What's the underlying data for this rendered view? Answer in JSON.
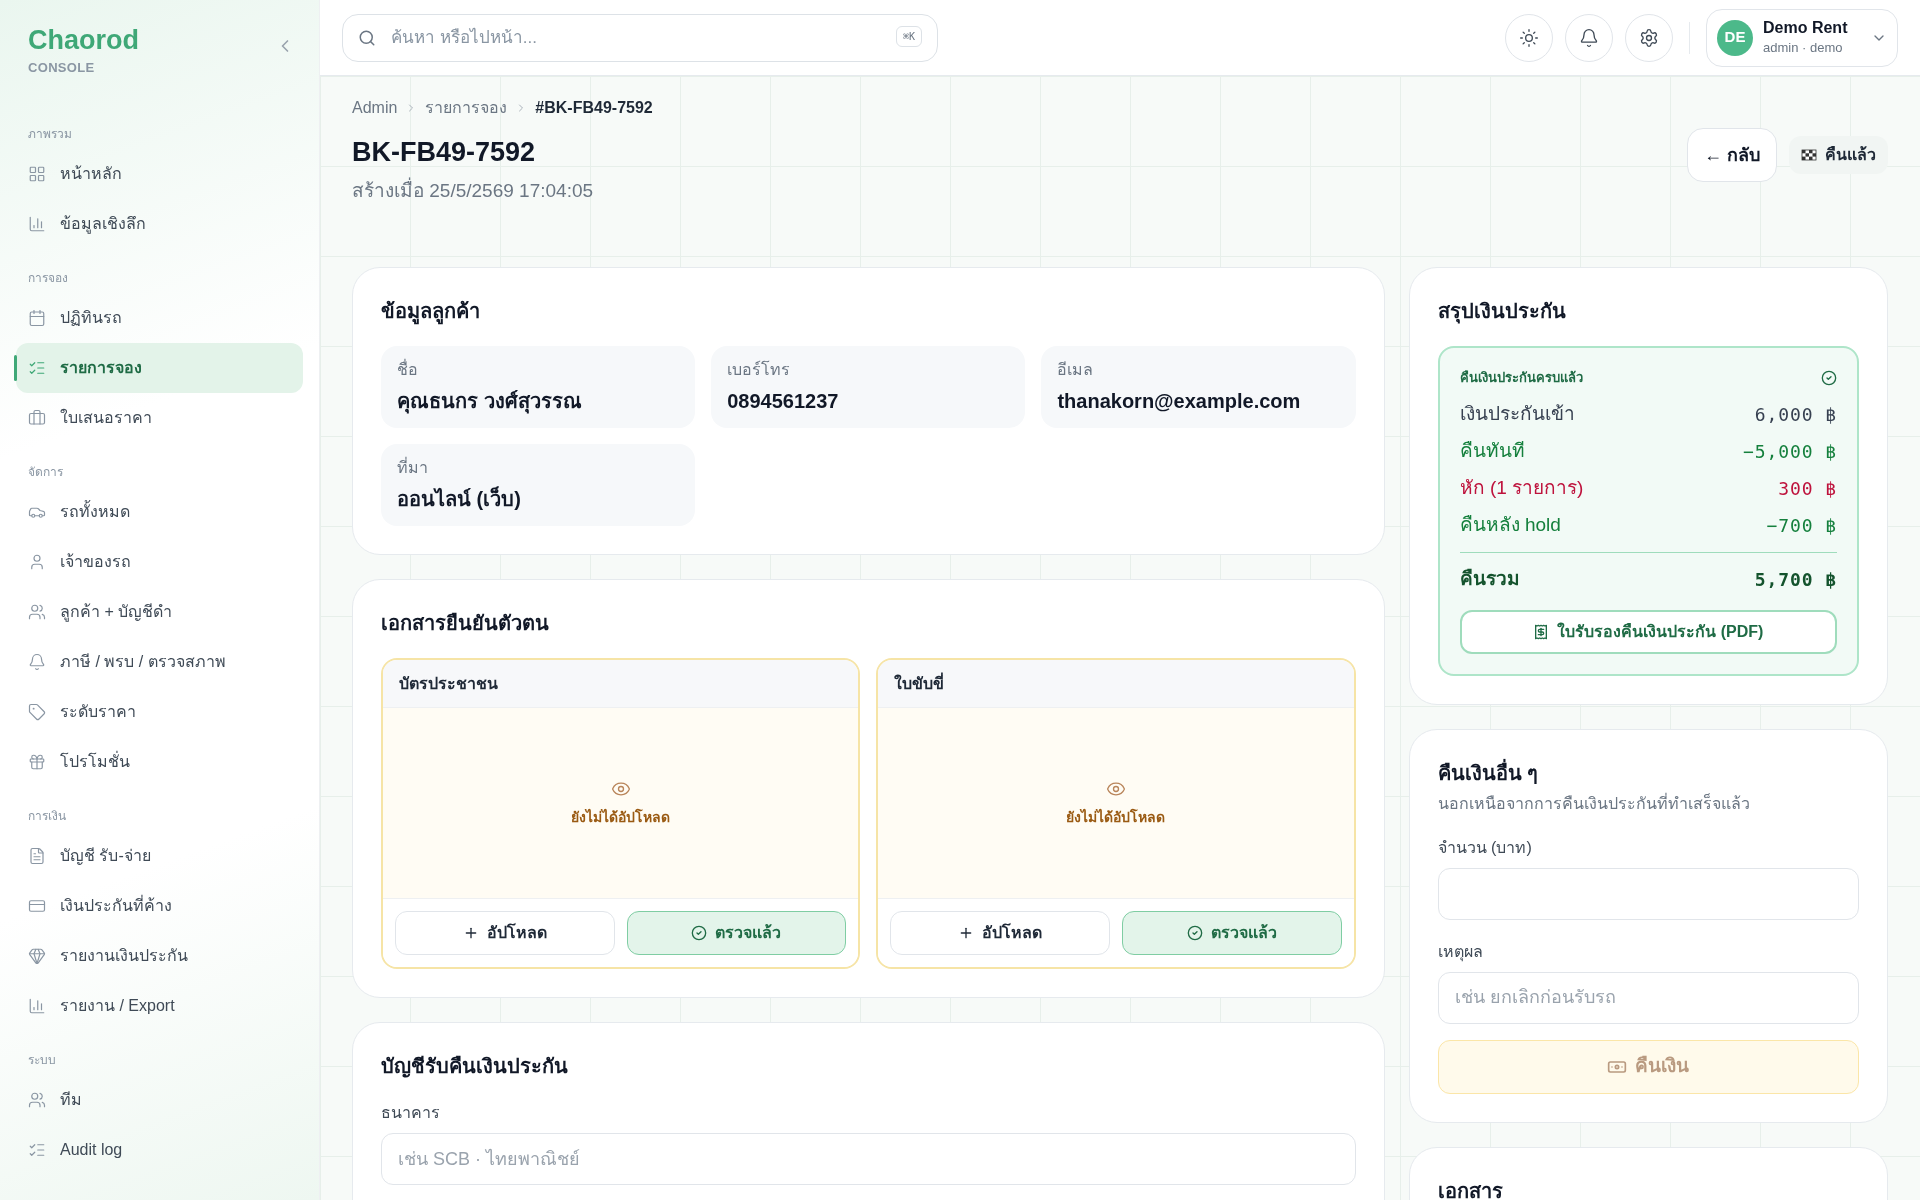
{
  "brand": {
    "name": "Chaorod",
    "subtitle": "CONSOLE"
  },
  "sidebar": {
    "sections": [
      {
        "title": "ภาพรวม",
        "items": [
          {
            "label": "หน้าหลัก",
            "selected": false
          },
          {
            "label": "ข้อมูลเชิงลึก",
            "selected": false
          }
        ]
      },
      {
        "title": "การจอง",
        "items": [
          {
            "label": "ปฏิทินรถ",
            "selected": false
          },
          {
            "label": "รายการจอง",
            "selected": true
          },
          {
            "label": "ใบเสนอราคา",
            "selected": false
          }
        ]
      },
      {
        "title": "จัดการ",
        "items": [
          {
            "label": "รถทั้งหมด",
            "selected": false
          },
          {
            "label": "เจ้าของรถ",
            "selected": false
          },
          {
            "label": "ลูกค้า + บัญชีดำ",
            "selected": false
          },
          {
            "label": "ภาษี / พรบ / ตรวจสภาพ",
            "selected": false
          },
          {
            "label": "ระดับราคา",
            "selected": false
          },
          {
            "label": "โปรโมชั่น",
            "selected": false
          }
        ]
      },
      {
        "title": "การเงิน",
        "items": [
          {
            "label": "บัญชี รับ-จ่าย",
            "selected": false
          },
          {
            "label": "เงินประกันที่ค้าง",
            "selected": false
          },
          {
            "label": "รายงานเงินประกัน",
            "selected": false
          },
          {
            "label": "รายงาน / Export",
            "selected": false
          }
        ]
      },
      {
        "title": "ระบบ",
        "items": [
          {
            "label": "ทีม",
            "selected": false
          },
          {
            "label": "Audit log",
            "selected": false
          }
        ]
      }
    ]
  },
  "topbar": {
    "search": {
      "placeholder": "ค้นหา หรือไปหน้า...",
      "shortcut": "⌘K"
    },
    "user": {
      "initials": "DE",
      "name": "Demo Rent",
      "role": "admin · demo"
    }
  },
  "header": {
    "breadcrumb": [
      "Admin",
      "รายการจอง",
      "#BK-FB49-7592"
    ],
    "title": "BK-FB49-7592",
    "created": "สร้างเมื่อ 25/5/2569 17:04:05",
    "back_button": "← กลับ",
    "status": "คืนแล้ว"
  },
  "customer": {
    "title": "ข้อมูลลูกค้า",
    "fields": [
      {
        "label": "ชื่อ",
        "value": "คุณธนกร วงศ์สุวรรณ"
      },
      {
        "label": "เบอร์โทร",
        "value": "0894561237"
      },
      {
        "label": "อีเมล",
        "value": "thanakorn@example.com"
      },
      {
        "label": "ที่มา",
        "value": "ออนไลน์ (เว็บ)"
      }
    ]
  },
  "documents": {
    "title": "เอกสารยืนยันตัวตน",
    "items": [
      {
        "title": "บัตรประชาชน",
        "status": "ยังไม่ได้อัปโหลด",
        "upload": "อัปโหลด",
        "verify": "ตรวจแล้ว",
        "verified": true
      },
      {
        "title": "ใบขับขี่",
        "status": "ยังไม่ได้อัปโหลด",
        "upload": "อัปโหลด",
        "verify": "ตรวจแล้ว",
        "verified": true
      }
    ]
  },
  "bank": {
    "title": "บัญชีรับคืนเงินประกัน",
    "label": "ธนาคาร",
    "placeholder": "เช่น SCB · ไทยพาณิชย์"
  },
  "summary": {
    "title": "สรุปเงินประกัน",
    "status": "คืนเงินประกันครบแล้ว",
    "rows": [
      {
        "kind": "neutral",
        "label": "เงินประกันเข้า",
        "amount": "6,000",
        "currency": "฿"
      },
      {
        "kind": "refund",
        "label": "คืนทันที",
        "amount": "−5,000",
        "currency": "฿"
      },
      {
        "kind": "deduct",
        "label": "หัก (1 รายการ)",
        "amount": "300",
        "currency": "฿"
      },
      {
        "kind": "refund",
        "label": "คืนหลัง hold",
        "amount": "−700",
        "currency": "฿"
      },
      {
        "kind": "total",
        "label": "คืนรวม",
        "amount": "5,700",
        "currency": "฿"
      }
    ],
    "pdf_button": "ใบรับรองคืนเงินประกัน (PDF)"
  },
  "other_refund": {
    "title": "คืนเงินอื่น ๆ",
    "subtitle": "นอกเหนือจากการคืนเงินประกันที่ทำเสร็จแล้ว",
    "amount_label": "จำนวน (บาท)",
    "reason_label": "เหตุผล",
    "reason_placeholder": "เช่น ยกเลิกก่อนรับรถ",
    "button": "คืนเงิน",
    "disabled": true
  },
  "files": {
    "title": "เอกสาร"
  }
}
